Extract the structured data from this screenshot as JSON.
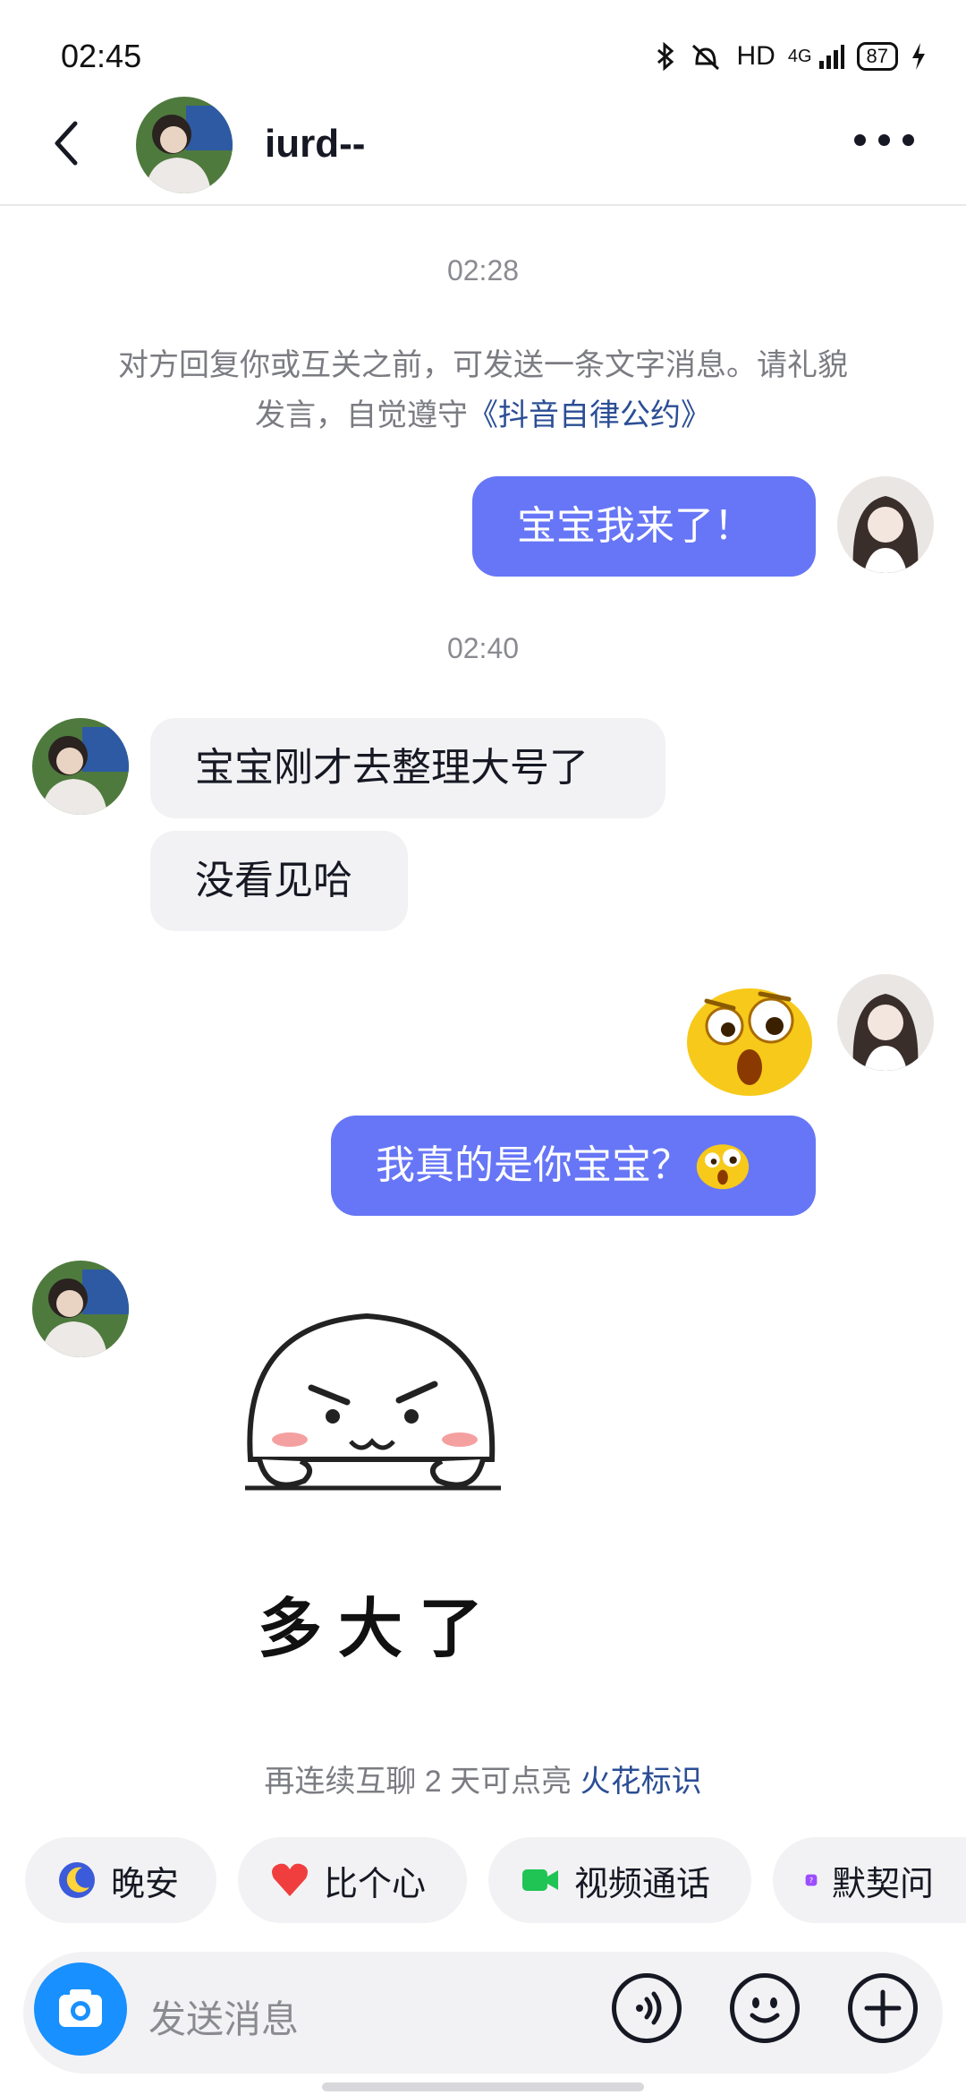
{
  "status": {
    "time": "02:45",
    "network": "HD",
    "signal": "4G",
    "battery": "87"
  },
  "header": {
    "title": "iurd--"
  },
  "chat": {
    "timestamp1": "02:28",
    "notice_text": "对方回复你或互关之前，可发送一条文字消息。请礼貌发言，自觉遵守",
    "notice_link": "《抖音自律公约》",
    "msg_me_1": "宝宝我来了！",
    "timestamp2": "02:40",
    "msg_other_1": "宝宝刚才去整理大号了",
    "msg_other_2": "没看见哈",
    "msg_me_2": "我真的是你宝宝？",
    "sticker_text": "多大了",
    "streak_hint": "再连续互聊 2 天可点亮",
    "streak_link": "火花标识"
  },
  "quick_replies": [
    {
      "label": "晚安",
      "icon": "moon-icon"
    },
    {
      "label": "比个心",
      "icon": "heart-icon"
    },
    {
      "label": "视频通话",
      "icon": "video-icon"
    },
    {
      "label": "默契问",
      "icon": "question-icon"
    }
  ],
  "input": {
    "placeholder": "发送消息"
  },
  "colors": {
    "accent": "#6676f6",
    "camera": "#1890ff",
    "link": "#2b4e95"
  }
}
